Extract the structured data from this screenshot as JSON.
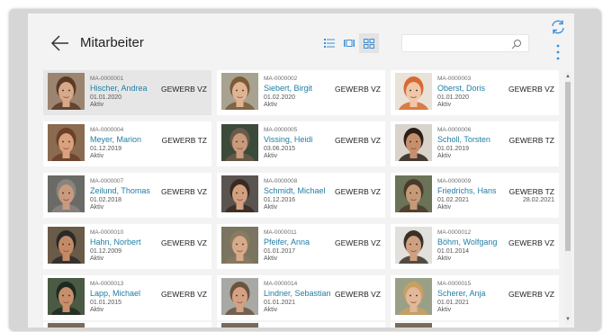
{
  "header": {
    "title": "Mitarbeiter",
    "search_placeholder": "",
    "views": [
      "list-view-icon",
      "tile-view-icon",
      "grid-view-icon"
    ],
    "active_view": "grid-view-icon"
  },
  "colors": {
    "accent": "#1f7ea4",
    "header_icon": "#3c8fd6"
  },
  "employees": [
    {
      "no": "MA-0000001",
      "name": "Hischer, Andrea",
      "date": "01.01.2020",
      "status": "Aktiv",
      "type": "GEWERB VZ",
      "end": "",
      "selected": true,
      "skin": "#d8a88a",
      "hair": "#5a3a24",
      "bg": "#9b8470"
    },
    {
      "no": "MA-0000002",
      "name": "Siebert, Birgit",
      "date": "01.02.2020",
      "status": "Aktiv",
      "type": "GEWERB VZ",
      "end": "",
      "selected": false,
      "skin": "#e0b492",
      "hair": "#7a5a3a",
      "bg": "#a8a290"
    },
    {
      "no": "MA-0000003",
      "name": "Oberst, Doris",
      "date": "01.01.2020",
      "status": "Aktiv",
      "type": "GEWERB VZ",
      "end": "",
      "selected": false,
      "skin": "#f0c7a8",
      "hair": "#d66a30",
      "bg": "#e9e2d8"
    },
    {
      "no": "MA-0000004",
      "name": "Meyer, Marion",
      "date": "01.12.2019",
      "status": "Aktiv",
      "type": "GEWERB TZ",
      "end": "",
      "selected": false,
      "skin": "#d9a27e",
      "hair": "#6a4026",
      "bg": "#8a6a50"
    },
    {
      "no": "MA-0000005",
      "name": "Vissing, Heidi",
      "date": "03.06.2015",
      "status": "Aktiv",
      "type": "GEWERB VZ",
      "end": "",
      "selected": false,
      "skin": "#c99a7c",
      "hair": "#6a5a4a",
      "bg": "#3c4a3a"
    },
    {
      "no": "MA-0000006",
      "name": "Scholl, Torsten",
      "date": "01.01.2019",
      "status": "Aktiv",
      "type": "GEWERB TZ",
      "end": "",
      "selected": false,
      "skin": "#c7906c",
      "hair": "#2a2018",
      "bg": "#d8d4cc"
    },
    {
      "no": "MA-0000007",
      "name": "Zeilund, Thomas",
      "date": "01.02.2018",
      "status": "Aktiv",
      "type": "GEWERB VZ",
      "end": "",
      "selected": false,
      "skin": "#c89a7e",
      "hair": "#8a8480",
      "bg": "#6a6a66"
    },
    {
      "no": "MA-0000008",
      "name": "Schmidt, Michael",
      "date": "01.12.2016",
      "status": "Aktiv",
      "type": "GEWERB VZ",
      "end": "",
      "selected": false,
      "skin": "#d2a080",
      "hair": "#3a2a20",
      "bg": "#5a5450"
    },
    {
      "no": "MA-0000009",
      "name": "Friedrichs, Hans",
      "date": "01.02.2021",
      "status": "Aktiv",
      "type": "GEWERB TZ",
      "end": "28.02.2021",
      "selected": false,
      "skin": "#c69a78",
      "hair": "#4a3a2a",
      "bg": "#6a7258"
    },
    {
      "no": "MA-0000010",
      "name": "Hahn, Norbert",
      "date": "01.12.2009",
      "status": "Aktiv",
      "type": "GEWERB VZ",
      "end": "",
      "selected": false,
      "skin": "#c48a66",
      "hair": "#2a2a2a",
      "bg": "#6a5a48"
    },
    {
      "no": "MA-0000011",
      "name": "Pfeifer, Anna",
      "date": "01.01.2017",
      "status": "Aktiv",
      "type": "GEWERB VZ",
      "end": "",
      "selected": false,
      "skin": "#d8aa8a",
      "hair": "#8a7a62",
      "bg": "#7a7460"
    },
    {
      "no": "MA-0000012",
      "name": "Böhm, Wolfgang",
      "date": "01.01.2014",
      "status": "Aktiv",
      "type": "GEWERB VZ",
      "end": "",
      "selected": false,
      "skin": "#cfa080",
      "hair": "#3a3028",
      "bg": "#e2e0dc"
    },
    {
      "no": "MA-0000013",
      "name": "Lapp, Michael",
      "date": "01.01.2015",
      "status": "Aktiv",
      "type": "GEWERB VZ",
      "end": "",
      "selected": false,
      "skin": "#c68e6a",
      "hair": "#1e2a20",
      "bg": "#4a5a44"
    },
    {
      "no": "MA-0000014",
      "name": "Lindner, Sebastian",
      "date": "01.01.2021",
      "status": "Aktiv",
      "type": "GEWERB VZ",
      "end": "",
      "selected": false,
      "skin": "#d4a282",
      "hair": "#6a5440",
      "bg": "#a8a8a4"
    },
    {
      "no": "MA-0000015",
      "name": "Scherer, Anja",
      "date": "01.01.2021",
      "status": "Aktiv",
      "type": "GEWERB VZ",
      "end": "",
      "selected": false,
      "skin": "#e2b898",
      "hair": "#c9a060",
      "bg": "#9aa088"
    }
  ]
}
